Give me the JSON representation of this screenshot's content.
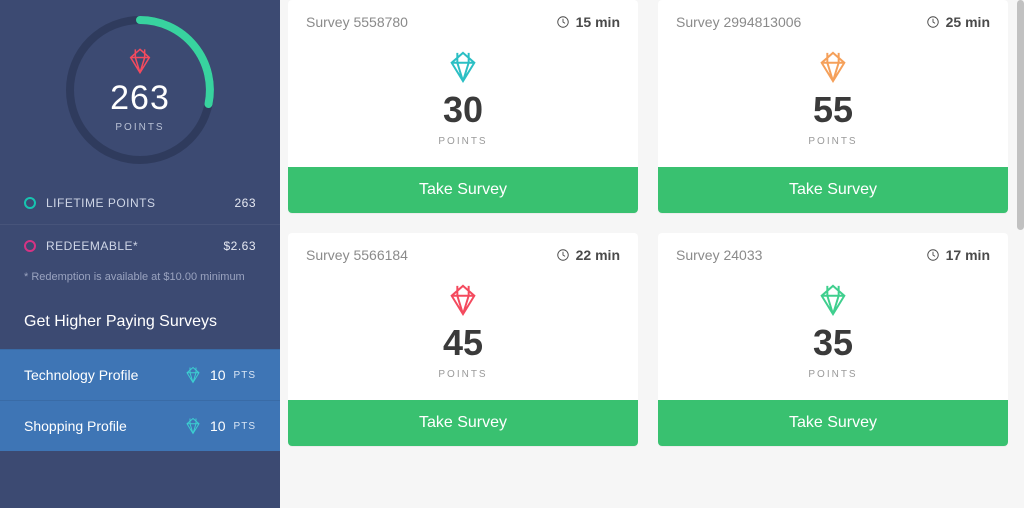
{
  "sidebar": {
    "points_value": "263",
    "points_label": "POINTS",
    "stats": {
      "lifetime": {
        "label": "LIFETIME POINTS",
        "value": "263"
      },
      "redeemable": {
        "label": "REDEEMABLE*",
        "value": "$2.63"
      }
    },
    "footnote": "* Redemption is available at $10.00 minimum",
    "cta_heading": "Get Higher Paying Surveys",
    "profiles": [
      {
        "label": "Technology Profile",
        "points": "10",
        "pts_label": "PTS"
      },
      {
        "label": "Shopping Profile",
        "points": "10",
        "pts_label": "PTS"
      }
    ]
  },
  "surveys": [
    {
      "name": "Survey 5558780",
      "time": "15 min",
      "points": "30",
      "points_label": "POINTS",
      "button": "Take Survey",
      "diamond_color": "#2bbfc4"
    },
    {
      "name": "Survey 2994813006",
      "time": "25 min",
      "points": "55",
      "points_label": "POINTS",
      "button": "Take Survey",
      "diamond_color": "#f5a05a"
    },
    {
      "name": "Survey 5566184",
      "time": "22 min",
      "points": "45",
      "points_label": "POINTS",
      "button": "Take Survey",
      "diamond_color": "#f44a5e"
    },
    {
      "name": "Survey 24033",
      "time": "17 min",
      "points": "35",
      "points_label": "POINTS",
      "button": "Take Survey",
      "diamond_color": "#3fcf8e"
    }
  ],
  "colors": {
    "sidebar_diamond": "#f44a5e",
    "arc_start": "#38d39f",
    "arc_track": "#2f3b5d"
  }
}
